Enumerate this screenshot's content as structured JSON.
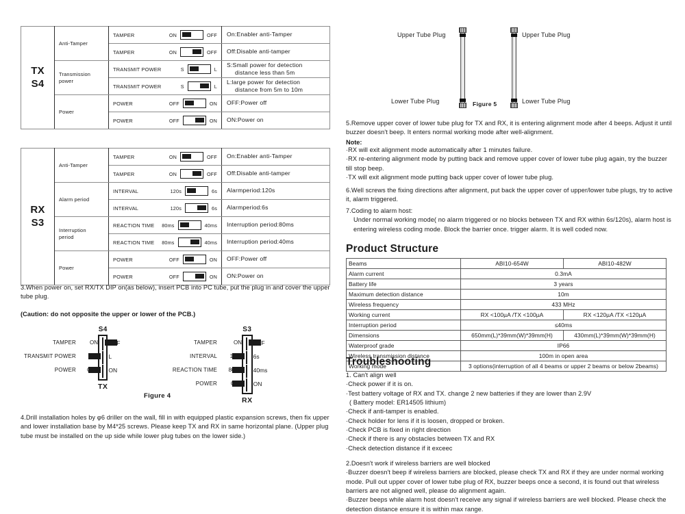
{
  "left": {
    "tx_table": {
      "unit": "TX\nS4",
      "unit_line1": "TX",
      "unit_line2": "S4",
      "groups": [
        {
          "label": "Anti-Tamper",
          "rows": [
            {
              "name": "TAMPER",
              "left_label": "ON",
              "right_label": "OFF",
              "position": "left",
              "desc": "On:Enabler anti-Tamper",
              "desc2": ""
            },
            {
              "name": "TAMPER",
              "left_label": "ON",
              "right_label": "OFF",
              "position": "right",
              "desc": "Off:Disable anti-tamper",
              "desc2": ""
            }
          ]
        },
        {
          "label": "Transmission power",
          "label_line1": "Transmission",
          "label_line2": "power",
          "rows": [
            {
              "name": "TRANSMIT POWER",
              "left_label": "S",
              "right_label": "L",
              "position": "left",
              "desc": "S:Small power for detection",
              "desc2": "distance less than 5m"
            },
            {
              "name": "TRANSMIT POWER",
              "left_label": "S",
              "right_label": "L",
              "position": "right",
              "desc": "L:large power for detection",
              "desc2": "distance from 5m to 10m"
            }
          ]
        },
        {
          "label": "Power",
          "rows": [
            {
              "name": "POWER",
              "left_label": "OFF",
              "right_label": "ON",
              "position": "left",
              "desc": "OFF:Power off",
              "desc2": ""
            },
            {
              "name": "POWER",
              "left_label": "OFF",
              "right_label": "ON",
              "position": "right",
              "desc": "ON:Power on",
              "desc2": ""
            }
          ]
        }
      ]
    },
    "rx_table": {
      "unit_line1": "RX",
      "unit_line2": "S3",
      "groups": [
        {
          "label": "Anti-Tamper",
          "rows": [
            {
              "name": "TAMPER",
              "left_label": "ON",
              "right_label": "OFF",
              "position": "left",
              "desc": "On:Enabler anti-Tamper",
              "desc2": ""
            },
            {
              "name": "TAMPER",
              "left_label": "ON",
              "right_label": "OFF",
              "position": "right",
              "desc": "Off:Disable anti-tamper",
              "desc2": ""
            }
          ]
        },
        {
          "label": "Alarm period",
          "rows": [
            {
              "name": "INTERVAL",
              "left_label": "120s",
              "right_label": "6s",
              "position": "left",
              "desc": "Alarmperiod:120s",
              "desc2": ""
            },
            {
              "name": "INTERVAL",
              "left_label": "120s",
              "right_label": "6s",
              "position": "right",
              "desc": "Alarmperiod:6s",
              "desc2": ""
            }
          ]
        },
        {
          "label": "Interruption period",
          "label_line1": "Interruption",
          "label_line2": "period",
          "rows": [
            {
              "name": "REACTION TIME",
              "left_label": "80ms",
              "right_label": "40ms",
              "position": "left",
              "desc": "Interruption period:80ms",
              "desc2": ""
            },
            {
              "name": "REACTION TIME",
              "left_label": "80ms",
              "right_label": "40ms",
              "position": "right",
              "desc": "Interruption period:40ms",
              "desc2": ""
            }
          ]
        },
        {
          "label": "Power",
          "rows": [
            {
              "name": "POWER",
              "left_label": "OFF",
              "right_label": "ON",
              "position": "left",
              "desc": "OFF:Power off",
              "desc2": ""
            },
            {
              "name": "POWER",
              "left_label": "OFF",
              "right_label": "ON",
              "position": "right",
              "desc": "ON:Power on",
              "desc2": ""
            }
          ]
        }
      ]
    },
    "step3": "3.When power on, set RX/TX DIP on(as below), insert PCB into PC tube, put the plug in and cover the upper tube plug.",
    "caution": "(Caution: do not opposite the upper or lower of the PCB.)",
    "figure4": {
      "caption": "Figure 4",
      "tx_block": {
        "title": "S4",
        "footer": "TX",
        "lines": [
          {
            "name": "TAMPER",
            "left_label": "ON",
            "right_label": "OFF",
            "position": "left"
          },
          {
            "name": "TRANSMIT POWER",
            "left_label": "S",
            "right_label": "L",
            "position": "right"
          },
          {
            "name": "POWER",
            "left_label": "OFF",
            "right_label": "ON",
            "position": "right"
          }
        ]
      },
      "rx_block": {
        "title": "S3",
        "footer": "RX",
        "lines": [
          {
            "name": "TAMPER",
            "left_label": "ON",
            "right_label": "OFF",
            "position": "left"
          },
          {
            "name": "INTERVAL",
            "left_label": "120s",
            "right_label": "6s",
            "position": "right"
          },
          {
            "name": "REACTION TIME",
            "left_label": "80ms",
            "right_label": "40ms",
            "position": "right"
          },
          {
            "name": "POWER",
            "left_label": "OFF",
            "right_label": "ON",
            "position": "right"
          }
        ]
      }
    },
    "step4": "4.Drill installation holes by φ6 driller on the wall, fill in with equipped plastic expansion screws, then fix upper and lower installation base by M4*25 screws. Please keep TX and RX in same horizontal plane. (Upper plug tube must be installed on the up side while lower plug tubes on the lower side.)"
  },
  "right": {
    "figure5": {
      "caption": "Figure 5",
      "left_tube": {
        "upper_label": "Upper Tube Plug",
        "lower_label": "Lower Tube Plug"
      },
      "right_tube": {
        "upper_label": "Upper Tube Plug",
        "lower_label": "Lower Tube Plug"
      }
    },
    "step5": "5.Remove upper cover of lower tube plug for TX and RX, it is entering alignment mode after 4 beeps. Adjust it until buzzer doesn't beep. It enters normal working mode after well-alignment.",
    "note_title": "Note:",
    "notes": [
      "·RX will exit alignment mode automatically after 1 minutes failure.",
      "·RX re-entering alignment mode by putting back and remove upper cover of lower tube plug again, try the buzzer till stop beep.",
      "·TX will exit alignment mode putting back upper cover of lower tube plug."
    ],
    "step6": "6.Well screws the fixing directions after alignment, put back the upper cover of upper/lower tube plugs, try to active it, alarm triggered.",
    "step7_title": "7.Coding to alarm host:",
    "step7_body": "Under normal working mode( no alarm triggered or no blocks between TX and RX within 6s/120s), alarm host is entering wireless coding mode. Block the barrier once. trigger alarm. It is well coded now.",
    "product_structure": {
      "heading": "Product Structure",
      "rows": [
        {
          "key": "Beams",
          "span": false,
          "v1": "ABI10-654W",
          "v2": "ABI10-482W"
        },
        {
          "key": "Alarm current",
          "span": true,
          "value": "0.3mA"
        },
        {
          "key": "Battery life",
          "span": true,
          "value": "3 years"
        },
        {
          "key": "Maximum detection distance",
          "span": true,
          "value": "10m"
        },
        {
          "key": "Wireless frequency",
          "span": true,
          "value": "433 MHz"
        },
        {
          "key": "Working current",
          "span": false,
          "v1": "RX <100µA /TX <100µA",
          "v2": "RX <120µA /TX <120µA"
        },
        {
          "key": "Interruption period",
          "span": true,
          "value": "≤40ms"
        },
        {
          "key": "Dimensions",
          "span": false,
          "v1": "650mm(L)*39mm(W)*39mm(H)",
          "v2": "430mm(L)*39mm(W)*39mm(H)"
        },
        {
          "key": "Waterproof grade",
          "span": true,
          "value": "IP66"
        },
        {
          "key": "Wireless transmission distance",
          "span": true,
          "value": "100m in open area"
        },
        {
          "key": "Working mode",
          "span": true,
          "value": "3 options(interruption of all 4 beams or upper 2 beams or below 2beams)"
        }
      ]
    },
    "troubleshooting": {
      "heading": "Troubleshooting",
      "item1_title": "1. Can't align well",
      "item1_points": [
        "·Check power if it is on.",
        "·Test battery voltage of RX and TX. change 2 new batteries if they are lower than 2.9V",
        "( Battery model: ER14505 lithium)",
        "·Check if anti-tamper is enabled.",
        "·Check holder for lens if it is loosen, dropped or broken.",
        "·Check PCB is fixed in right direction",
        "·Check if there is any obstacles between TX and RX",
        "·Check detection distance if it exceec"
      ],
      "item2_title": "2.Doesn't work if wireless barriers are well blocked",
      "item2_points": [
        "·Buzzer doesn't beep if wireless barriers are blocked, please check TX and RX if they are under normal working mode. Pull out upper cover of lower tube plug of RX, buzzer beeps once a second, it is found out that wireless barriers are not aligned well, please do alignment again.",
        "·Buzzer beeps while alarm host doesn't receive any signal if wireless barriers are well blocked. Please check the detection distance ensure it is within max range."
      ]
    }
  }
}
